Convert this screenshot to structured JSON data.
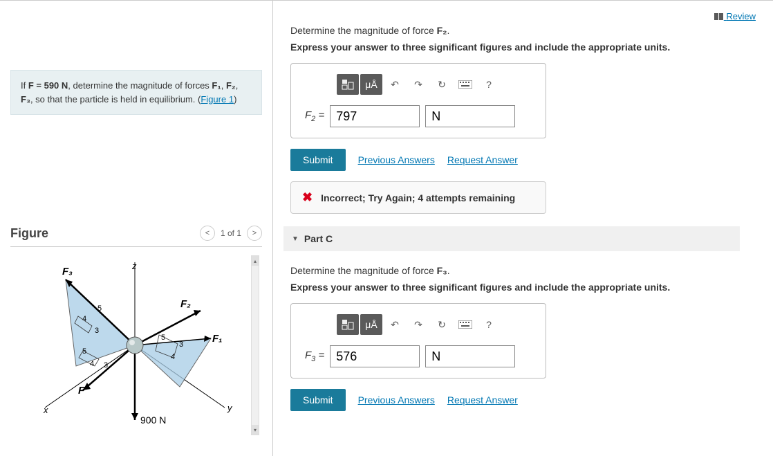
{
  "review_label": "Review",
  "problem": {
    "pre1": "If ",
    "f_expr": "F = 590 N",
    "pre2": ", determine the magnitude of forces ",
    "f1": "F₁",
    "comma": ", ",
    "f2": "F₂",
    "comma2": ", ",
    "f3": "F₃",
    "post": ", so that the particle is held in equilibrium. (",
    "link": "Figure 1",
    "close": ")"
  },
  "figure": {
    "title": "Figure",
    "nav": "1 of 1",
    "prev": "<",
    "next": ">",
    "labels": {
      "F3": "F₃",
      "F2": "F₂",
      "F1": "F₁",
      "F": "F",
      "z": "z",
      "x": "x",
      "y": "y",
      "n900": "900 N",
      "d3a": "3",
      "d3b": "3",
      "d3c": "3",
      "d4a": "4",
      "d4b": "4",
      "d4c": "4",
      "d5a": "5",
      "d5b": "5",
      "d5c": "5"
    }
  },
  "partB": {
    "question_pre": "Determine the magnitude of force ",
    "question_f": "F₂",
    "question_post": ".",
    "instruction": "Express your answer to three significant figures and include the appropriate units.",
    "label_pre": "F",
    "label_sub": "2",
    "label_post": " = ",
    "value": "797",
    "unit": "N",
    "submit": "Submit",
    "prev_answers": "Previous Answers",
    "request": "Request Answer",
    "feedback": "Incorrect; Try Again; 4 attempts remaining",
    "toolbar": {
      "units": "μÅ",
      "undo": "↶",
      "redo": "↷",
      "reset": "↻",
      "help": "?"
    }
  },
  "partC": {
    "header": "Part C",
    "question_pre": "Determine the magnitude of force ",
    "question_f": "F₃",
    "question_post": ".",
    "instruction": "Express your answer to three significant figures and include the appropriate units.",
    "label_pre": "F",
    "label_sub": "3",
    "label_post": " = ",
    "value": "576",
    "unit": "N",
    "submit": "Submit",
    "prev_answers": "Previous Answers",
    "request": "Request Answer",
    "toolbar": {
      "units": "μÅ",
      "undo": "↶",
      "redo": "↷",
      "reset": "↻",
      "help": "?"
    }
  }
}
